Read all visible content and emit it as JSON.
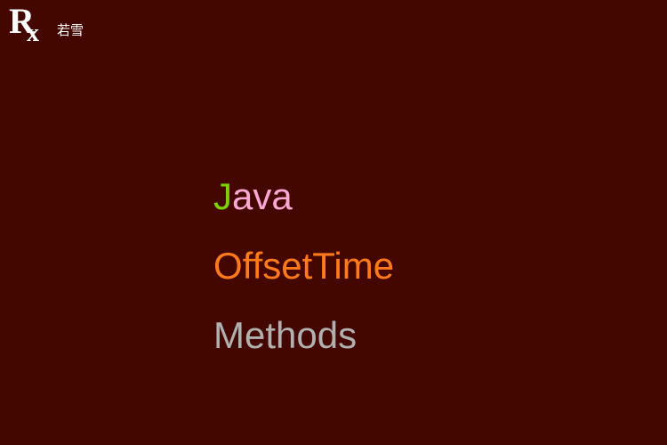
{
  "logo": {
    "r": "R",
    "x": "x",
    "text": "若雪"
  },
  "heading": {
    "line1": {
      "first": "J",
      "rest": "ava"
    },
    "line2": "OffsetTime",
    "line3": "Methods"
  }
}
